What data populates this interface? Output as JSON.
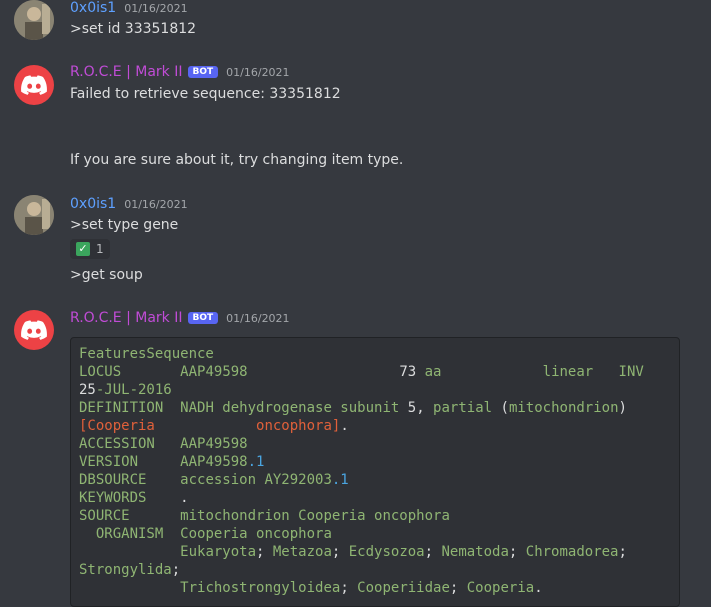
{
  "messages": [
    {
      "author": "0x0is1",
      "timestamp": "01/16/2021",
      "lines": [
        ">set id 33351812"
      ]
    },
    {
      "author": "R.O.C.E | Mark II",
      "bot_badge": "BOT",
      "timestamp": "01/16/2021",
      "lines": [
        "Failed to retrieve sequence: 33351812",
        "If you are sure about it, try changing item type."
      ]
    },
    {
      "author": "0x0is1",
      "timestamp": "01/16/2021",
      "lines": [
        ">set type gene",
        ">get soup"
      ],
      "reaction": {
        "emoji": "white-check-mark",
        "count": "1"
      }
    },
    {
      "author": "R.O.C.E | Mark II",
      "bot_badge": "BOT",
      "timestamp": "01/16/2021"
    }
  ],
  "code": {
    "l0": "FeaturesSequence",
    "locus_key": "LOCUS",
    "locus_id": "AAP49598",
    "locus_len": "73",
    "locus_unit": "aa",
    "locus_topo": "linear",
    "locus_div": "INV",
    "date_day": "25",
    "date_rest": "-JUL-2016",
    "def_key": "DEFINITION",
    "def_text": "NADH dehydrogenase subunit",
    "def_num": "5",
    "def_partial": "partial",
    "def_mito": "mitochondrion",
    "def_species_a": "[Cooperia",
    "def_species_b": "oncophora]",
    "acc_key": "ACCESSION",
    "acc_val": "AAP49598",
    "ver_key": "VERSION",
    "ver_val": "AAP49598",
    "ver_num": ".1",
    "db_key": "DBSOURCE",
    "db_val": "accession AY292003",
    "db_num": ".1",
    "kw_key": "KEYWORDS",
    "kw_val": ".",
    "src_key": "SOURCE",
    "src_val": "mitochondrion Cooperia oncophora",
    "org_key": "ORGANISM",
    "org_val": "Cooperia oncophora",
    "tax1": "Eukaryota",
    "tax2": "Metazoa",
    "tax3": "Ecdysozoa",
    "tax4": "Nematoda",
    "tax5": "Chromadorea",
    "tax6": "Strongylida",
    "tax7": "Trichostrongyloidea",
    "tax8": "Cooperiidae",
    "tax9": "Cooperia"
  }
}
